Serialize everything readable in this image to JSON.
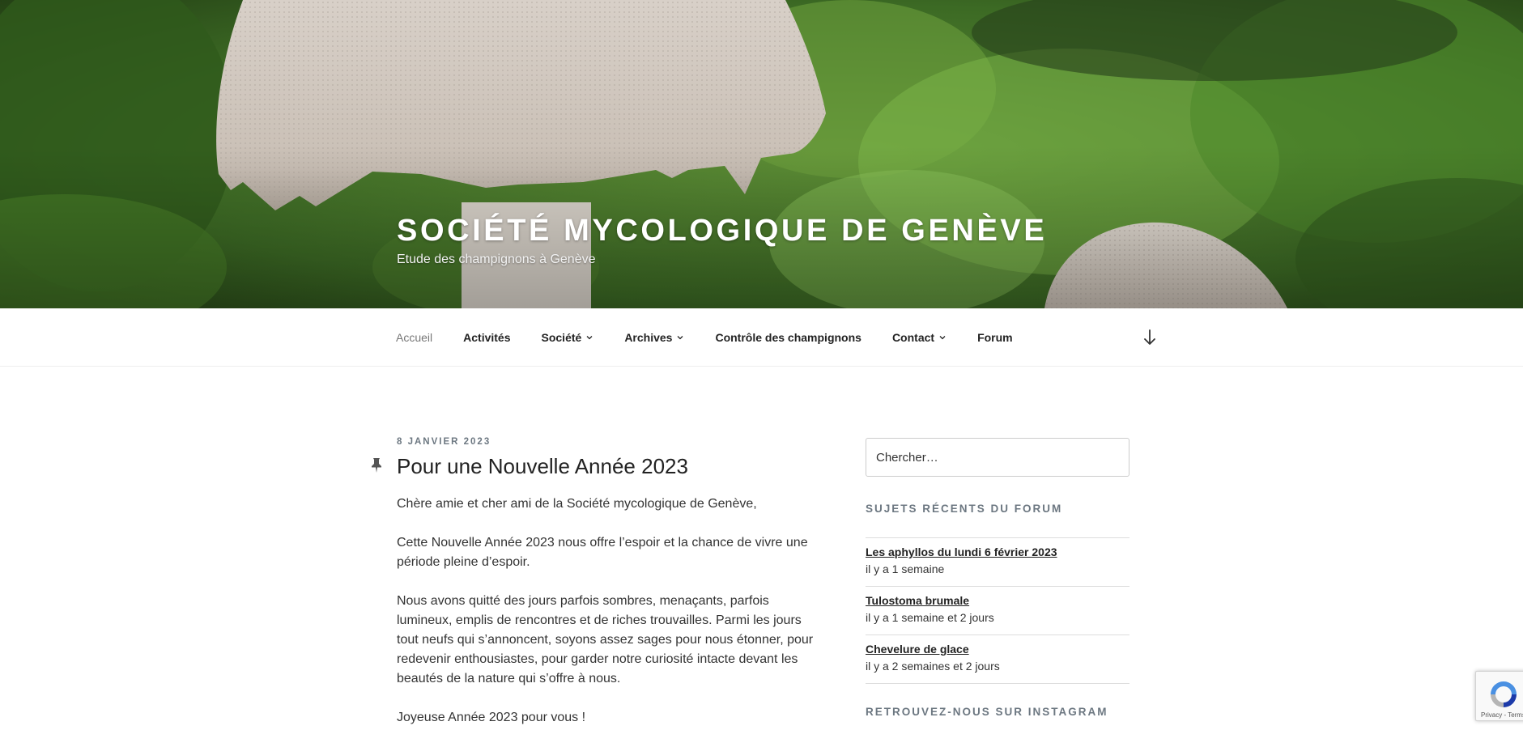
{
  "header": {
    "site_title": "SOCIÉTÉ MYCOLOGIQUE DE GENÈVE",
    "tagline": "Etude des champignons à Genève"
  },
  "nav": {
    "items": [
      {
        "label": "Accueil",
        "current": true,
        "has_submenu": false
      },
      {
        "label": "Activités",
        "current": false,
        "has_submenu": false
      },
      {
        "label": "Société",
        "current": false,
        "has_submenu": true
      },
      {
        "label": "Archives",
        "current": false,
        "has_submenu": true
      },
      {
        "label": "Contrôle des champignons",
        "current": false,
        "has_submenu": false
      },
      {
        "label": "Contact",
        "current": false,
        "has_submenu": true
      },
      {
        "label": "Forum",
        "current": false,
        "has_submenu": false
      }
    ],
    "scroll_icon": "arrow-down-icon"
  },
  "post": {
    "date": "8 JANVIER 2023",
    "title": "Pour une Nouvelle Année 2023",
    "paragraphs": [
      "Chère amie et cher ami de la Société mycologique de Genève,",
      "Cette Nouvelle Année 2023 nous offre l’espoir et la chance de vivre une période pleine d’espoir.",
      "Nous avons quitté des jours parfois sombres, menaçants, parfois lumineux, emplis de rencontres et de riches trouvailles. Parmi les jours tout neufs qui s’annoncent, soyons assez sages pour nous étonner, pour redevenir enthousiastes, pour garder notre curiosité intacte devant les beautés de la nature qui s’offre à nous.",
      "Joyeuse Année 2023 pour vous !"
    ],
    "pin_icon": "pin-icon"
  },
  "sidebar": {
    "search_placeholder": "Chercher…",
    "forum_widget_title": "SUJETS RÉCENTS DU FORUM",
    "forum_topics": [
      {
        "title": "Les aphyllos du lundi 6 février 2023",
        "time": "il y a 1 semaine"
      },
      {
        "title": "Tulostoma brumale",
        "time": "il y a 1 semaine et 2 jours"
      },
      {
        "title": "Chevelure de glace",
        "time": "il y a 2 semaines et 2 jours"
      }
    ],
    "instagram_widget_title": "RETROUVEZ-NOUS SUR INSTAGRAM"
  },
  "recaptcha": {
    "terms": "Privacy - Terms"
  },
  "colors": {
    "text_dark": "#222222",
    "text_body": "#333333",
    "meta_gray": "#6c7781",
    "nav_current": "#767676",
    "divider": "#dddddd"
  }
}
